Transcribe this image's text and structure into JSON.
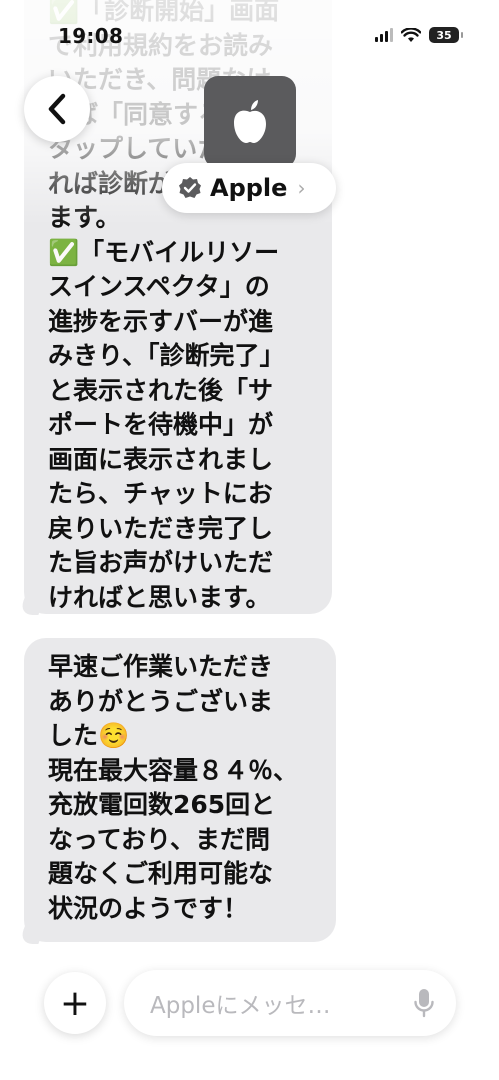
{
  "status_bar": {
    "time": "19:08",
    "battery": "35"
  },
  "header": {
    "contact_name": "Apple"
  },
  "messages": [
    {
      "faded_lines": "✅「診断開始」画面\nで利用規約をお読み\nいただき、問題なけ\nれば「同意する」を\nタップしていただけ\nれば診断が開始され",
      "lines": "ます。\n✅「モバイルリソー\nスインスペクタ」の\n進捗を示すバーが進\nみきり、「診断完了」\nと表示された後「サ\nポートを待機中」が\n画面に表示されまし\nたら、チャットにお\n戻りいただき完了し\nた旨お声がけいただ\nければと思います。"
    },
    {
      "lines": "早速ご作業いただき\nありがとうございま\nした☺️\n現在最大容量８４％、\n充放電回数265回と\nなっており、まだ問\n題なくご利用可能な\n状況のようです！"
    }
  ],
  "composer": {
    "add_label": "+",
    "placeholder": "Appleにメッセ…"
  }
}
